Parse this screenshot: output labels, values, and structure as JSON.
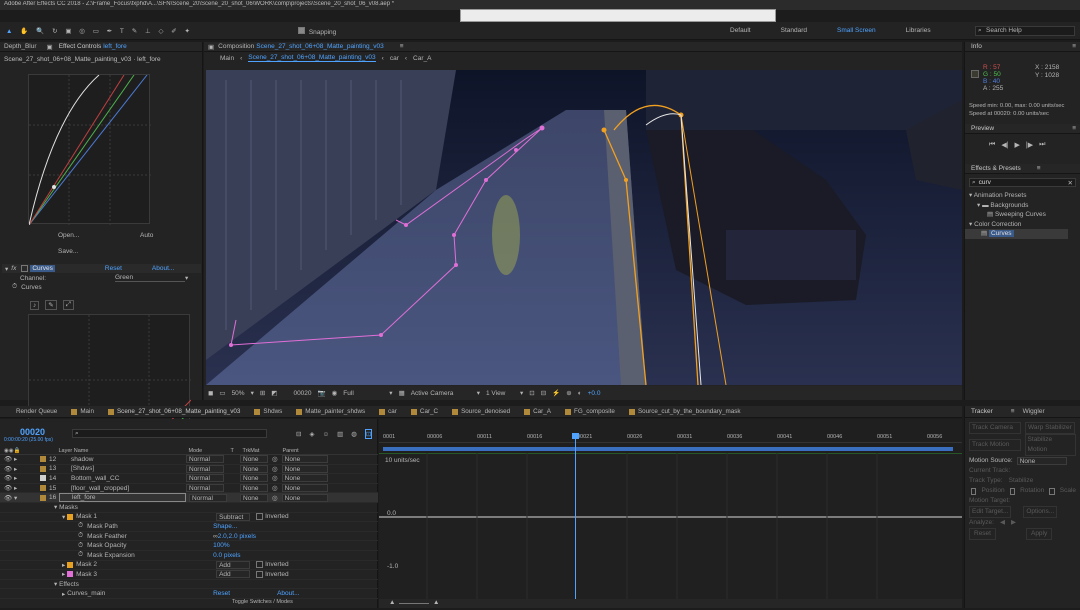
{
  "app": {
    "title": "Adobe After Effects CC 2018 - Z:\\Frame_Focus\\fxphd\\A...\\SFN\\Scene_20\\Scene_20_shot_06\\WORK\\comp\\projects\\Scene_20_shot_06_v08.aep *",
    "workspaces": [
      "Default",
      "Standard",
      "Small Screen",
      "Libraries"
    ],
    "search_placeholder": "Search Help",
    "snapping": "Snapping"
  },
  "left_panel": {
    "tab_main": "Depth_Blur",
    "tab_effect": "Effect Controls",
    "tab_effect_layer": "left_fore",
    "breadcrumb": "Scene_27_shot_06+08_Matte_painting_v03 · left_fore",
    "open_btn": "Open...",
    "auto_btn": "Auto",
    "save_btn": "Save...",
    "fx_name": "Curves",
    "reset": "Reset",
    "about": "About...",
    "channel_label": "Channel:",
    "channel_value": "Green",
    "curves_label": "Curves"
  },
  "composition": {
    "panel_label": "Composition",
    "comp_name": "Scene_27_shot_06+08_Matte_painting_v03",
    "nav": [
      "Main",
      "Scene_27_shot_06+08_Matte_painting_v03",
      "car",
      "Car_A"
    ],
    "zoom": "50%",
    "timecode": "00020",
    "resolution": "Full",
    "camera": "Active Camera",
    "views": "1 View",
    "exposure": "+0.0"
  },
  "info": {
    "title": "Info",
    "r": "R : 57",
    "g": "G : 50",
    "b": "B : 40",
    "a": "A : 255",
    "x": "X : 2158",
    "y": "Y : 1028",
    "speed1": "Speed min: 0.00, max: 0.00 units/sec",
    "speed2": "Speed at 00020: 0.00 units/sec",
    "swatch_color": "#3a3a30"
  },
  "preview": {
    "title": "Preview"
  },
  "effects_presets": {
    "title": "Effects & Presets",
    "search": "curv",
    "tree": [
      {
        "label": "Animation Presets",
        "indent": 0
      },
      {
        "label": "Backgrounds",
        "indent": 1
      },
      {
        "label": "Sweeping Curves",
        "indent": 2
      },
      {
        "label": "Color Correction",
        "indent": 0
      },
      {
        "label": "Curves",
        "indent": 1
      }
    ]
  },
  "timeline_tabs": [
    "Render Queue",
    "Main",
    "Scene_27_shot_06+08_Matte_painting_v03",
    "Shdws",
    "Matte_painter_shdws",
    "car",
    "Car_C",
    "Source_denoised",
    "Car_A",
    "FG_composite",
    "Source_cut_by_the_boundary_mask"
  ],
  "timeline": {
    "current_time": "00020",
    "time_sub": "0:00:00:20 (25.00 fps)",
    "col_layer": "Layer Name",
    "col_mode": "Mode",
    "col_t": "T",
    "col_trkmat": "TrkMat",
    "col_parent": "Parent",
    "layers": [
      {
        "num": "12",
        "name": "shadow",
        "mode": "Normal",
        "trk": "None",
        "parent": "None",
        "color": "#b08a3a"
      },
      {
        "num": "13",
        "name": "[Shdws]",
        "mode": "Normal",
        "trk": "None",
        "parent": "None",
        "color": "#b08a3a"
      },
      {
        "num": "14",
        "name": "Bottom_wall_CC",
        "mode": "Normal",
        "trk": "None",
        "parent": "None",
        "color": "#d0d0d0"
      },
      {
        "num": "15",
        "name": "[floor_wall_cropped]",
        "mode": "Normal",
        "trk": "None",
        "parent": "None",
        "color": "#b08a3a"
      },
      {
        "num": "16",
        "name": "left_fore",
        "mode": "Normal",
        "trk": "None",
        "parent": "None",
        "color": "#b08a3a"
      }
    ],
    "masks_label": "Masks",
    "mask1": "Mask 1",
    "mask1_mode": "Subtract",
    "inverted": "Inverted",
    "mask_path": "Mask Path",
    "mask_path_val": "Shape...",
    "mask_feather": "Mask Feather",
    "mask_feather_val": "2.0,2.0 pixels",
    "mask_opacity": "Mask Opacity",
    "mask_opacity_val": "100%",
    "mask_expansion": "Mask Expansion",
    "mask_expansion_val": "0.0 pixels",
    "mask2": "Mask 2",
    "mask2_mode": "Add",
    "mask3": "Mask 3",
    "mask3_mode": "Add",
    "effects_label": "Effects",
    "curves_main": "Curves_main",
    "reset": "Reset",
    "about": "About...",
    "toggle": "Toggle Switches / Modes",
    "ruler": [
      "0001",
      "00006",
      "00011",
      "00016",
      "00021",
      "00026",
      "00031",
      "00036",
      "00041",
      "00046",
      "00051",
      "00056"
    ],
    "graph_units": "10 units/sec",
    "graph_zero": "0.0",
    "graph_neg": "-1.0"
  },
  "tracker": {
    "title": "Tracker",
    "wiggler": "Wiggler",
    "btn_track_camera": "Track Camera",
    "btn_warp": "Warp Stabilizer",
    "btn_track_motion": "Track Motion",
    "btn_stabilize": "Stabilize Motion",
    "motion_source": "Motion Source:",
    "motion_source_val": "None",
    "current_track": "Current Track:",
    "track_type": "Track Type:",
    "track_type_val": "Stabilize",
    "position": "Position",
    "rotation": "Rotation",
    "scale": "Scale",
    "motion_target": "Motion Target:",
    "edit_target": "Edit Target...",
    "options": "Options...",
    "analyze": "Analyze:",
    "reset": "Reset",
    "apply": "Apply"
  }
}
